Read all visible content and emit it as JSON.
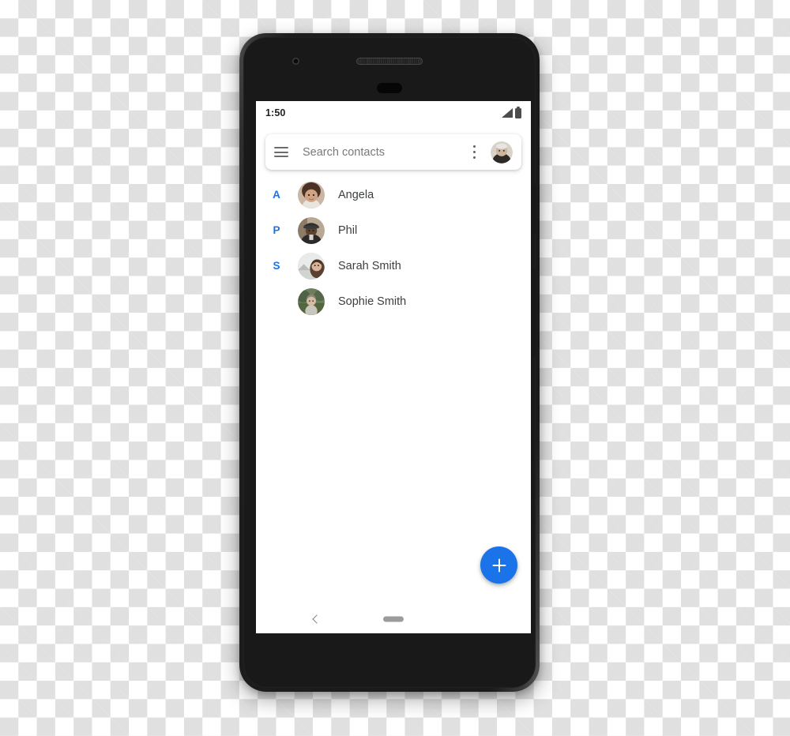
{
  "device": {
    "name": "android-phone-mockup",
    "front_camera": "front-camera-icon",
    "earpiece": "earpiece-speaker-icon",
    "proximity_sensor": "proximity-sensor-icon",
    "power_button": "power-button",
    "volume_rocker": "volume-rocker-button"
  },
  "status_bar": {
    "time": "1:50",
    "signal_icon": "signal-strength-icon",
    "battery_icon": "battery-icon"
  },
  "search": {
    "placeholder": "Search contacts",
    "value": "",
    "menu_icon": "hamburger-menu-icon",
    "overflow_icon": "overflow-menu-icon",
    "avatar_icon": "account-avatar"
  },
  "contacts": [
    {
      "section": "A",
      "name": "Angela"
    },
    {
      "section": "P",
      "name": "Phil"
    },
    {
      "section": "S",
      "name": "Sarah Smith"
    },
    {
      "section": "",
      "name": "Sophie Smith"
    }
  ],
  "fab": {
    "label": "+",
    "name": "add-contact-button",
    "color": "#1a73e8"
  },
  "navigation": {
    "back_icon": "chevron-left-icon",
    "home_pill": "home-gesture-pill"
  },
  "colors": {
    "accent": "#1a73e8",
    "text_primary": "#3c4043",
    "text_secondary": "#5f6368",
    "screen_bg": "#ffffff"
  }
}
